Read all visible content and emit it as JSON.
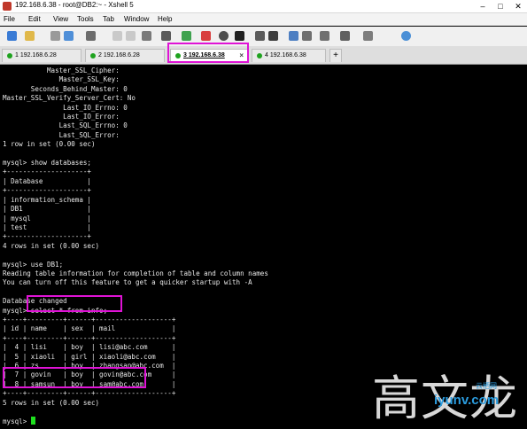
{
  "window": {
    "title": "192.168.6.38 - root@DB2:~ - Xshell 5",
    "controls": [
      "–",
      "□",
      "✕"
    ]
  },
  "menu": [
    "File",
    "Edit",
    "View",
    "Tools",
    "Tab",
    "Window",
    "Help"
  ],
  "toolbar": {
    "icons": [
      "new-session-icon",
      "open-folder-icon",
      "disconnect-icon",
      "reconnect-icon",
      "properties-icon",
      "copy-icon",
      "paste-icon",
      "find-icon",
      "print-icon",
      "transfer-icon",
      "xftp-icon",
      "globe-icon",
      "font-icon",
      "color-scheme-icon",
      "script-icon",
      "fullscreen-icon",
      "lock-icon",
      "keyboard-icon",
      "compose-icon",
      "add-icon",
      "help-icon"
    ]
  },
  "tabs": [
    {
      "num": "1",
      "label": "192.168.6.28",
      "active": false
    },
    {
      "num": "2",
      "label": "192.168.6.28",
      "active": false
    },
    {
      "num": "3",
      "label": "192.168.6.38",
      "active": true
    },
    {
      "num": "4",
      "label": "192.168.6.38",
      "active": false
    }
  ],
  "add_tab": "+",
  "terminal": {
    "text": "           Master_SSL_Cipher: \n              Master_SSL_Key: \n       Seconds_Behind_Master: 0\nMaster_SSL_Verify_Server_Cert: No\n               Last_IO_Errno: 0\n               Last_IO_Error: \n              Last_SQL_Errno: 0\n              Last_SQL_Error: \n1 row in set (0.00 sec)\n\nmysql> show databases;\n+--------------------+\n| Database           |\n+--------------------+\n| information_schema |\n| DB1                |\n| mysql              |\n| test               |\n+--------------------+\n4 rows in set (0.00 sec)\n\nmysql> use DB1;\nReading table information for completion of table and column names\nYou can turn off this feature to get a quicker startup with -A\n\nDatabase changed\nmysql> select * from info;\n+----+---------+------+-------------------+\n| id | name    | sex  | mail              |\n+----+---------+------+-------------------+\n|  4 | lisi    | boy  | lisi@abc.com      |\n|  5 | xiaoli  | girl | xiaoli@abc.com    |\n|  6 | zs      | boy  | zhangsan@abc.com  |\n|  7 | govin   | boy  | govin@abc.com     |\n|  8 | samsun  | boy  | sam@abc.com       |\n+----+---------+------+-------------------+\n5 rows in set (0.00 sec)\n\n",
    "prompt": "mysql> "
  },
  "watermark": "高文龙",
  "site_logo": "iyunv.com",
  "site_logo_small": "云栖网",
  "colors": {
    "highlight": "#e013d6",
    "cursor": "#1ee01e",
    "tab_dot": "#1fa31f"
  }
}
